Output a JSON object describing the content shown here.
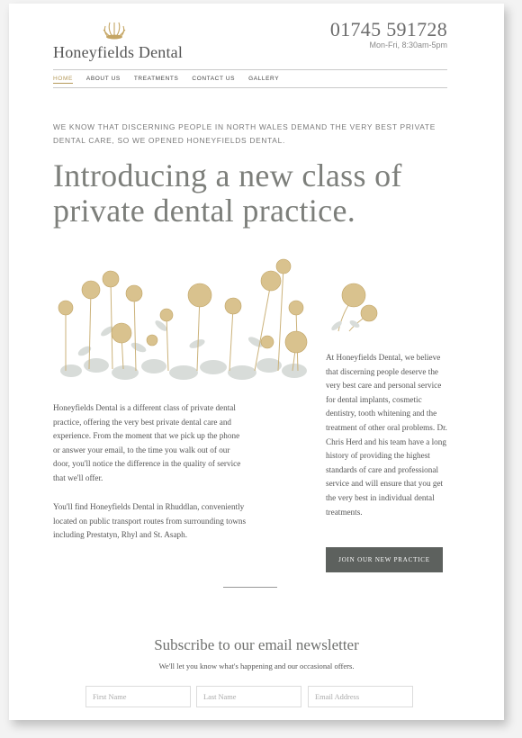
{
  "header": {
    "brand_name": "Honeyfields Dental",
    "phone": "01745 591728",
    "hours": "Mon-Fri, 8:30am-5pm",
    "logo_icon": "flower-logo-icon",
    "accent_color": "#b59a5a"
  },
  "nav": {
    "items": [
      {
        "label": "HOME",
        "active": true
      },
      {
        "label": "ABOUT US",
        "active": false
      },
      {
        "label": "TREATMENTS",
        "active": false
      },
      {
        "label": "CONTACT US",
        "active": false
      },
      {
        "label": "GALLERY",
        "active": false
      }
    ]
  },
  "main": {
    "intro": "WE KNOW THAT DISCERNING PEOPLE IN NORTH WALES DEMAND THE VERY BEST PRIVATE DENTAL CARE, SO WE OPENED HONEYFIELDS DENTAL.",
    "hero_title": "Introducing a new class of private dental practice.",
    "para1": "Honeyfields Dental is a different class of private dental practice, offering the very best private dental care and experience. From the moment that we pick up the phone or answer your email, to the time you walk out of our door, you'll notice the difference in the quality of service that we'll offer.",
    "para2": "You'll find Honeyfields Dental in Rhuddlan, conveniently located on public transport routes from surrounding towns including Prestatyn, Rhyl and St. Asaph.",
    "right_text": "At Honeyfields Dental, we believe that discerning people deserve the very best care and personal service for dental implants, cosmetic dentistry, tooth whitening and the treatment of other oral problems.  Dr. Chris Herd and his team have a long history of providing the highest standards of care and professional service and will ensure that you get the very best in individual dental treatments.",
    "join_button": "JOIN OUR NEW PRACTICE",
    "button_color": "#5d615e"
  },
  "newsletter": {
    "title": "Subscribe to our email newsletter",
    "subtitle": "We'll let you know what's happening and our occasional offers.",
    "first_name_placeholder": "First Name",
    "last_name_placeholder": "Last Name",
    "email_placeholder": "Email Address"
  }
}
